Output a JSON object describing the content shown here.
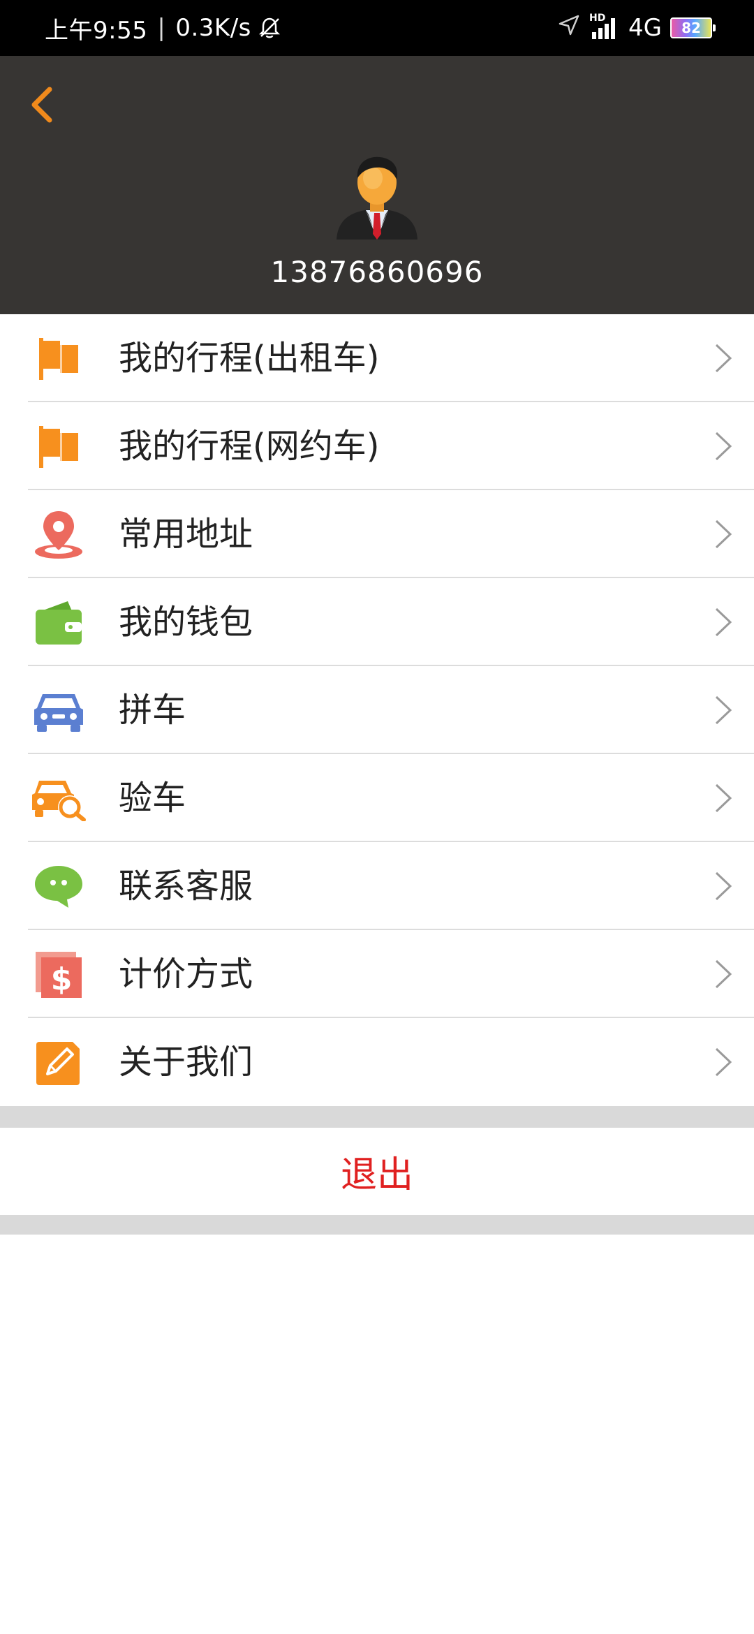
{
  "status_bar": {
    "time": "上午9:55",
    "separator": "|",
    "speed": "0.3K/s",
    "network": "4G",
    "hd": "HD",
    "battery": "82",
    "icons": [
      "silent-bell-icon",
      "location-arrow-icon",
      "signal-icon",
      "battery-icon"
    ]
  },
  "header": {
    "back_icon": "chevron-left-icon",
    "avatar": "businessman-avatar",
    "phone": "13876860696",
    "background": "#373533",
    "accent": "#f08a1c"
  },
  "menu": {
    "items": [
      {
        "label": "我的行程(出租车)",
        "icon": "flag-icon",
        "color": "#f7901e"
      },
      {
        "label": "我的行程(网约车)",
        "icon": "flag-icon",
        "color": "#f7901e"
      },
      {
        "label": "常用地址",
        "icon": "location-pin-icon",
        "color": "#ec6a5e"
      },
      {
        "label": "我的钱包",
        "icon": "wallet-icon",
        "color": "#7ac143"
      },
      {
        "label": "拼车",
        "icon": "car-icon",
        "color": "#5b7fd1"
      },
      {
        "label": "验车",
        "icon": "car-inspect-icon",
        "color": "#f7901e"
      },
      {
        "label": "联系客服",
        "icon": "chat-bubble-icon",
        "color": "#7ac143"
      },
      {
        "label": "计价方式",
        "icon": "dollar-icon",
        "color": "#ec6a5e"
      },
      {
        "label": "关于我们",
        "icon": "edit-icon",
        "color": "#f7901e"
      }
    ]
  },
  "logout": {
    "label": "退出",
    "color": "#e02020"
  }
}
